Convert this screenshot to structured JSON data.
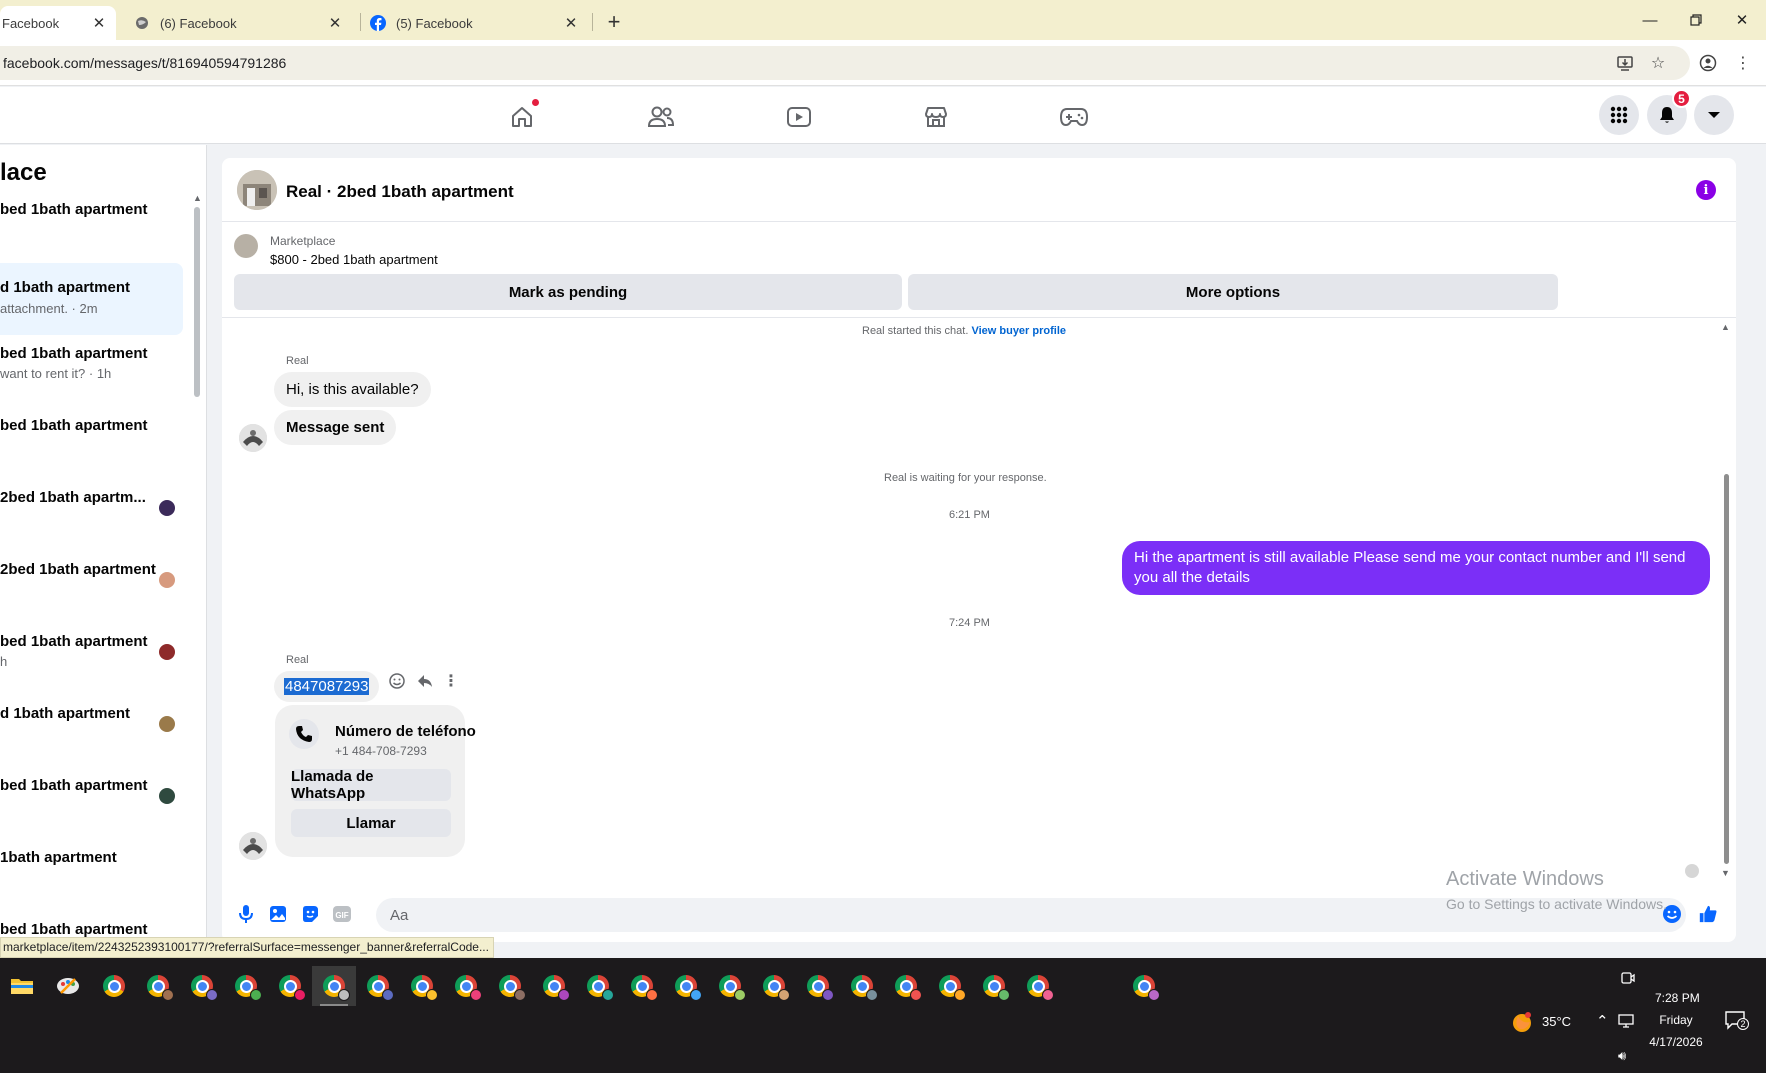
{
  "browser": {
    "tabs": [
      {
        "label": "Facebook"
      },
      {
        "label": "(6) Facebook"
      },
      {
        "label": "(5) Facebook"
      }
    ],
    "url": "facebook.com/messages/t/816940594791286",
    "status_link": "marketplace/item/2243252393100177/?referralSurface=messenger_banner&referralCode..."
  },
  "facebook": {
    "notifications_badge": "5"
  },
  "left_panel": {
    "title": "lace",
    "items": [
      {
        "title": "bed 1bath apartment",
        "subtitle": ""
      },
      {
        "title": "d 1bath apartment",
        "subtitle": "attachment. · 2m"
      },
      {
        "title": "bed 1bath apartment",
        "subtitle": "want to rent it? · 1h"
      },
      {
        "title": "bed 1bath apartment",
        "subtitle": ""
      },
      {
        "title": "2bed 1bath apartm...",
        "subtitle": ""
      },
      {
        "title": "2bed 1bath apartment",
        "subtitle": ""
      },
      {
        "title": "bed 1bath apartment",
        "subtitle": "h"
      },
      {
        "title": "d 1bath apartment",
        "subtitle": ""
      },
      {
        "title": "bed 1bath apartment",
        "subtitle": ""
      },
      {
        "title": "1bath apartment",
        "subtitle": ""
      },
      {
        "title": "bed 1bath apartment",
        "subtitle": ""
      }
    ]
  },
  "chat": {
    "title": "Real · 2bed 1bath apartment",
    "listing": {
      "category": "Marketplace",
      "name": "$800 - 2bed 1bath apartment",
      "mark_pending": "Mark as pending",
      "more_options": "More options"
    },
    "started_text": "Real started this chat.",
    "view_buyer_profile": "View buyer profile",
    "sender_1": "Real",
    "msg_1": "Hi, is this available?",
    "msg_2": "Message sent",
    "waiting_text": "Real is waiting for your response.",
    "time_1": "6:21 PM",
    "msg_out": "Hi the apartment is still available Please send me your contact number and I'll send you all the details",
    "time_2": "7:24 PM",
    "sender_2": "Real",
    "phone_msg": "4847087293",
    "phone_card": {
      "title": "Número de teléfono",
      "number": "+1 484-708-7293",
      "whatsapp": "Llamada de WhatsApp",
      "call": "Llamar"
    },
    "composer_placeholder": "Aa"
  },
  "watermark": {
    "line1": "Activate Windows",
    "line2": "Go to Settings to activate Windows."
  },
  "taskbar": {
    "temperature": "35°C",
    "time": "7:28 PM",
    "day": "Friday",
    "date": "4/17/2026",
    "notif_count": "2"
  },
  "colors": {
    "outgoing_bubble": "#7b2ff7",
    "link_blue": "#0064d1",
    "fb_blue": "#0866ff",
    "tab_strip": "#f3efcf"
  }
}
